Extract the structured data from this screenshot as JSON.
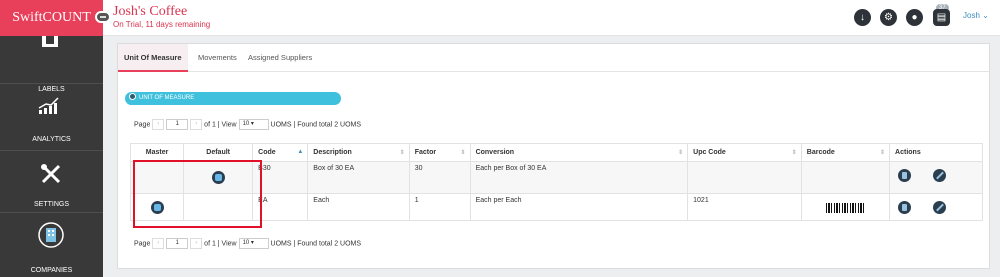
{
  "brand": {
    "logo_text": "SwiftCOUNT"
  },
  "header": {
    "shop_name": "Josh's Coffee",
    "trial_text": "On Trial, 11 days remaining",
    "notification_count": "37",
    "user_name": "Josh",
    "user_caret": "⌄",
    "icons": [
      "download-icon",
      "settings-icon",
      "notification-icon",
      "clipboard-icon"
    ]
  },
  "sidebar": {
    "items": [
      {
        "label": "LABELS",
        "icon": "labels-icon"
      },
      {
        "label": "ANALYTICS",
        "icon": "analytics-icon"
      },
      {
        "label": "SETTINGS",
        "icon": "settings-tools-icon"
      },
      {
        "label": "COMPANIES",
        "icon": "companies-icon"
      }
    ]
  },
  "tabs": [
    {
      "label": "Unit Of Measure",
      "active": true
    },
    {
      "label": "Movements",
      "active": false
    },
    {
      "label": "Assigned Suppliers",
      "active": false
    }
  ],
  "section_pill": {
    "label": "UNIT OF MEASURE"
  },
  "pager": {
    "page_label": "Page",
    "prev": "‹",
    "next": "›",
    "page_value": "1",
    "of_text": "of 1 | View",
    "view_value": "10",
    "view_caret": "▾",
    "summary": "UOMS | Found total 2 UOMS"
  },
  "table": {
    "columns": [
      "Master",
      "Default",
      "Code",
      "Description",
      "Factor",
      "Conversion",
      "Upc Code",
      "Barcode",
      "Actions"
    ],
    "sort_indicator": "▲",
    "sortable_indicator": "⇕",
    "rows": [
      {
        "master": false,
        "default": true,
        "code": "B30",
        "description": "Box of 30 EA",
        "factor": "30",
        "conversion": "Each per Box of 30 EA",
        "upc": "",
        "barcode": false
      },
      {
        "master": true,
        "default": false,
        "code": "EA",
        "description": "Each",
        "factor": "1",
        "conversion": "Each per Each",
        "upc": "1021",
        "barcode": true
      }
    ]
  },
  "colors": {
    "brand": "#e8405a",
    "sidebar": "#393939",
    "accent": "#3fc0dd",
    "highlight": "#e2112a"
  }
}
